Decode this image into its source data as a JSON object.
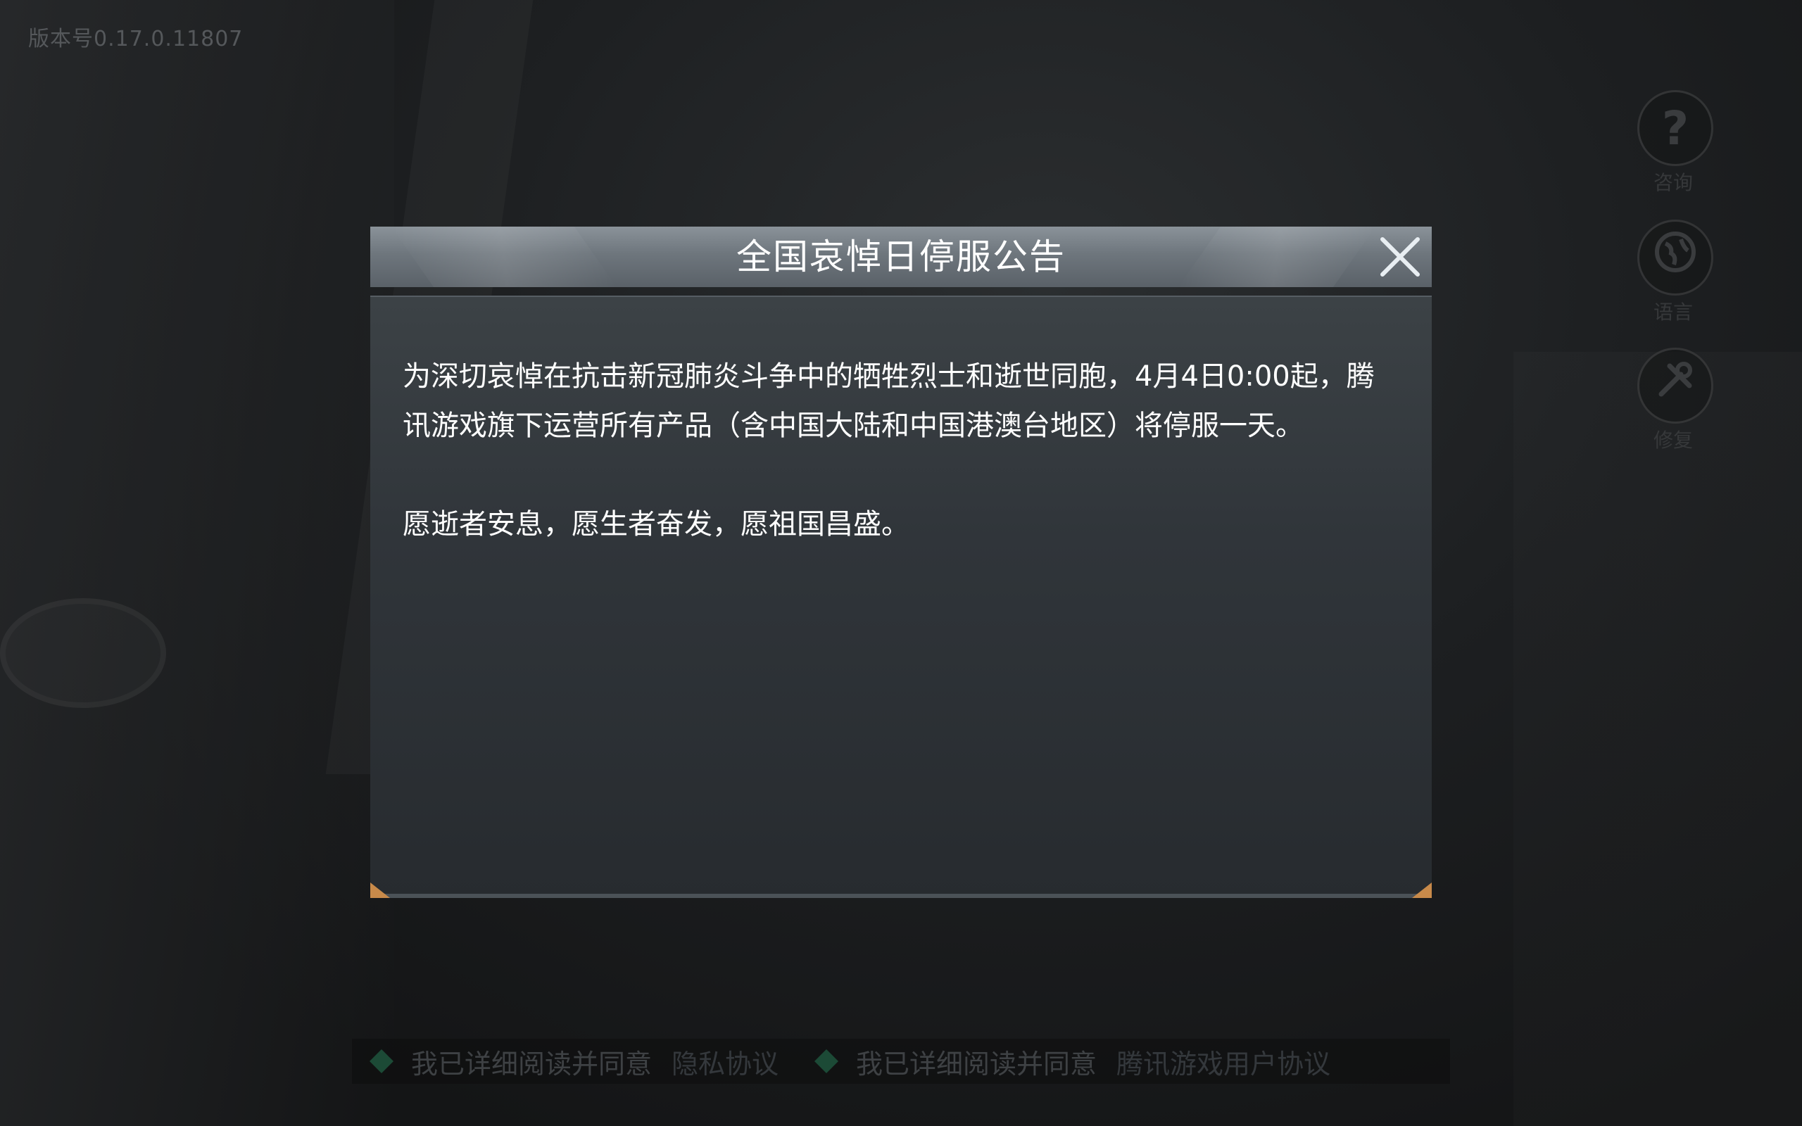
{
  "version_label": "版本号0.17.0.11807",
  "side_buttons": [
    {
      "icon": "question-icon",
      "label": "咨询"
    },
    {
      "icon": "globe-icon",
      "label": "语言"
    },
    {
      "icon": "wrench-icon",
      "label": "修复"
    }
  ],
  "dialog": {
    "title": "全国哀悼日停服公告",
    "paragraphs": [
      "为深切哀悼在抗击新冠肺炎斗争中的牺牲烈士和逝世同胞，4月4日0:00起，腾讯游戏旗下运营所有产品（含中国大陆和中国港澳台地区）将停服一天。",
      "愿逝者安息，愿生者奋发，愿祖国昌盛。"
    ]
  },
  "agreements": [
    {
      "text": "我已详细阅读并同意",
      "link": "隐私协议"
    },
    {
      "text": "我已详细阅读并同意",
      "link": "腾讯游戏用户协议"
    }
  ],
  "colors": {
    "header_top": "#8a9299",
    "body_bg": "#30353a",
    "accent_corner": "#c88a4a",
    "agree_check": "#1c4a36"
  }
}
